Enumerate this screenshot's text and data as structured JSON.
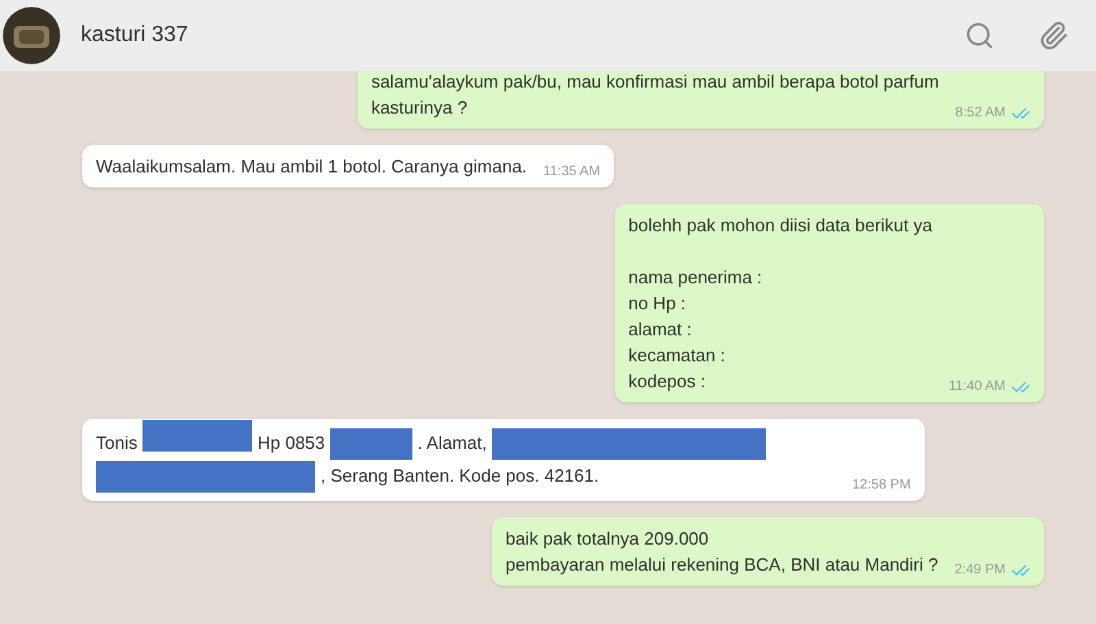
{
  "contact": {
    "name": "kasturi 337"
  },
  "messages": [
    {
      "kind": "out",
      "text": "salamu'alaykum pak/bu, mau konfirmasi mau ambil berapa botol parfum\nkasturinya ?",
      "time": "8:52 AM",
      "read": true
    },
    {
      "kind": "in",
      "text": "Waalaikumsalam. Mau ambil 1 botol. Caranya gimana.",
      "time": "11:35 AM"
    },
    {
      "kind": "out",
      "text": "bolehh pak mohon diisi data berikut ya\n\nnama penerima :\nno Hp :\nalamat :\nkecamatan :\nkodepos :",
      "time": "11:40 AM",
      "read": true
    },
    {
      "kind": "in",
      "segments": [
        {
          "kind": "text",
          "text": "Tonis"
        },
        {
          "kind": "redaction"
        },
        {
          "kind": "text",
          "text": "Hp 0853"
        },
        {
          "kind": "redaction"
        },
        {
          "kind": "text",
          "text": ". Alamat,"
        },
        {
          "kind": "redaction"
        },
        {
          "kind": "redaction"
        },
        {
          "kind": "text",
          "text": ", Serang Banten. Kode pos. 42161."
        }
      ],
      "time": "12:58 PM"
    },
    {
      "kind": "out",
      "text": "baik pak totalnya 209.000\npembayaran melalui rekening BCA, BNI atau Mandiri ?",
      "time": "2:49 PM",
      "read": true
    }
  ]
}
